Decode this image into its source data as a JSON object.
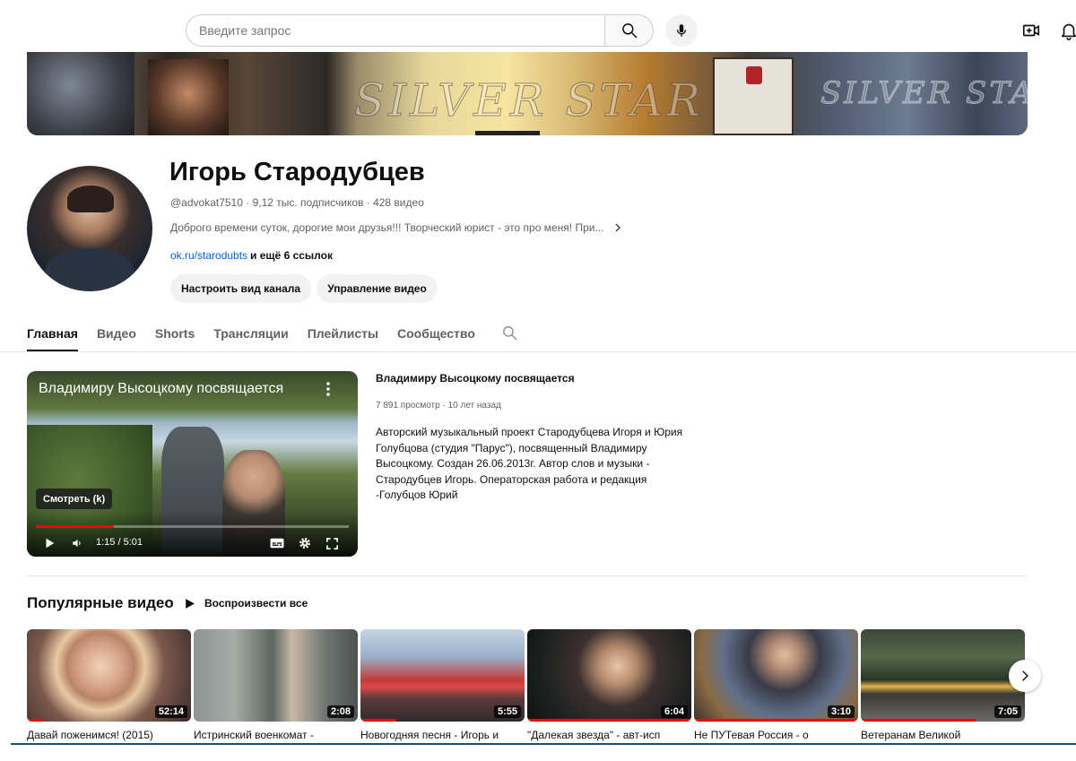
{
  "search": {
    "placeholder": "Введите запрос"
  },
  "channel": {
    "name": "Игорь Стародубцев",
    "meta": "@advokat7510 · 9,12 тыс. подписчиков · 428 видео",
    "description": "Доброго времени суток, дорогие мои друзья!!! Творческий юрист - это про меня! При...",
    "link_text": "ok.ru/starodubts",
    "links_more": "и ещё 6 ссылок",
    "customize_label": "Настроить вид канала",
    "manage_label": "Управление видео",
    "banner_text_1": "SILVER STAR",
    "banner_text_2": "SILVER STAR"
  },
  "tabs": [
    {
      "label": "Главная",
      "active": true
    },
    {
      "label": "Видео",
      "active": false
    },
    {
      "label": "Shorts",
      "active": false
    },
    {
      "label": "Трансляции",
      "active": false
    },
    {
      "label": "Плейлисты",
      "active": false
    },
    {
      "label": "Сообщество",
      "active": false
    }
  ],
  "featured": {
    "overlay_title": "Владимиру Высоцкому посвящается",
    "watch_tooltip": "Смотреть (k)",
    "time": "1:15 / 5:01",
    "progress": 0.25,
    "title": "Владимиру Высоцкому посвящается",
    "meta": "7 891 просмотр · 10 лет назад",
    "description": "Авторский музыкальный проект Стародубцева Игоря и Юрия Голубцова (студия \"Парус\"), посвященный Владимиру Высоцкому. Создан 26.06.2013г. Автор слов и музыки - Стародубцев Игорь. Операторская работа и редакция -Голубцов Юрий"
  },
  "popular": {
    "title": "Популярные видео",
    "play_all": "Воспроизвести все",
    "videos": [
      {
        "title": "Давай поженимся! (2015)",
        "duration": "52:14",
        "watched": 0.1
      },
      {
        "title": "Истринский военкомат -",
        "duration": "2:08",
        "watched": 0
      },
      {
        "title": "Новогодняя песня - Игорь и",
        "duration": "5:55",
        "watched": 0.22
      },
      {
        "title": "\"Далекая звезда\" - авт-исп",
        "duration": "6:04",
        "watched": 1.0
      },
      {
        "title": "Не ПУТевая Россия - о",
        "duration": "3:10",
        "watched": 1.0
      },
      {
        "title": "Ветеранам Великой",
        "duration": "7:05",
        "watched": 0.7
      }
    ]
  },
  "icons": {
    "search": "search-icon",
    "mic": "mic-icon",
    "create": "create-video-icon",
    "bell": "bell-icon",
    "chevron": "chevron-right-icon",
    "play": "play-icon",
    "volume": "volume-icon",
    "subtitles": "subtitles-icon",
    "settings": "gear-icon",
    "fullscreen": "fullscreen-icon",
    "more": "more-vert-icon"
  },
  "colors": {
    "accent": "#ff0000",
    "link": "#065fd4",
    "text": "#0f0f0f",
    "muted": "#606060"
  }
}
